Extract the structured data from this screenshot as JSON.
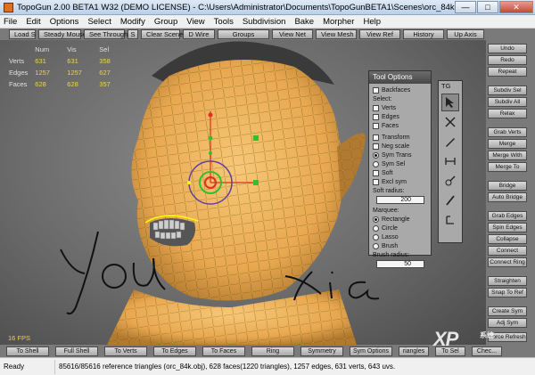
{
  "window": {
    "title": "TopoGun 2.00 BETA1 W32  (DEMO LICENSE)  - C:\\Users\\Administrator\\Documents\\TopoGunBETA1\\Scenes\\orc_84k.tgs",
    "controls": {
      "minimize": "—",
      "maximize": "□",
      "close": "✕"
    }
  },
  "menu": [
    "File",
    "Edit",
    "Options",
    "Select",
    "Modify",
    "Group",
    "View",
    "Tools",
    "Subdivision",
    "Bake",
    "Morpher",
    "Help"
  ],
  "toolbar": [
    "Load S",
    "Steady Mouse",
    "See Through",
    "S",
    "Clear Scene",
    "D Wire",
    "Groups",
    "View Net",
    "View Mesh",
    "View Ref",
    "History",
    "Up Axis"
  ],
  "stats": {
    "headers": [
      "Num",
      "Vis",
      "Sel"
    ],
    "rows": [
      {
        "label": "Verts",
        "num": "631",
        "vis": "631",
        "sel": "358"
      },
      {
        "label": "Edges",
        "num": "1257",
        "vis": "1257",
        "sel": "627"
      },
      {
        "label": "Faces",
        "num": "628",
        "vis": "628",
        "sel": "357"
      }
    ]
  },
  "fps": "16 FPS",
  "handwriting": {
    "left": "You",
    "right": "Xia"
  },
  "tool_options": {
    "title": "Tool Options",
    "backfaces": "Backfaces",
    "select_label": "Select:",
    "select": [
      "Verts",
      "Edges",
      "Faces"
    ],
    "transform": "Transform",
    "neg_scale": "Neg scale",
    "sym_trans": "Sym Trans",
    "sym_sel": "Sym Sel",
    "soft": "Soft",
    "excl_sym": "Excl sym",
    "soft_radius_label": "Soft radius:",
    "soft_radius": "200",
    "marquee_label": "Marquee:",
    "marquee": [
      "Rectangle",
      "Circle",
      "Lasso",
      "Brush"
    ],
    "brush_radius_label": "Brush radius:",
    "brush_radius": "50"
  },
  "tg_panel": {
    "title": "TG",
    "tools": [
      "select-tool-icon",
      "cut-tool-icon",
      "pen-tool-icon",
      "bridge-tool-icon",
      "relax-tool-icon",
      "brush-tool-icon",
      "tweak-tool-icon"
    ]
  },
  "right_buttons": [
    "Undo",
    "Redo",
    "Repeat",
    "Subdiv Sel",
    "Subdiv All",
    "Relax",
    "Grab Verts",
    "Merge",
    "Merge With",
    "Merge To",
    "Bridge",
    "Auto Bridge",
    "Grab Edges",
    "Spin Edges",
    "Collapse",
    "Connect",
    "Connect Ring",
    "Straighten",
    "Snap To Ref",
    "Create Sym",
    "Adj Sym",
    "Force Refresh"
  ],
  "bottom_buttons": [
    "To Shell",
    "Full Shell",
    "To Verts",
    "To Edges",
    "To Faces",
    "Ring",
    "Symmetry",
    "Sym Options",
    "riangles",
    "To Sel",
    "Chec..."
  ],
  "status": {
    "left": "Ready",
    "info": "85616/85616 reference triangles (orc_84k.obj), 628 faces(1220 triangles), 1257 edges, 631 verts, 643 uvs."
  },
  "watermark": {
    "text": "XP",
    "small": "系统"
  },
  "colors": {
    "mesh": "#f0b860",
    "mesh_line": "#6a4a10",
    "selection": "#ffff00",
    "gizmo_red": "#e03020",
    "gizmo_green": "#30c030"
  }
}
